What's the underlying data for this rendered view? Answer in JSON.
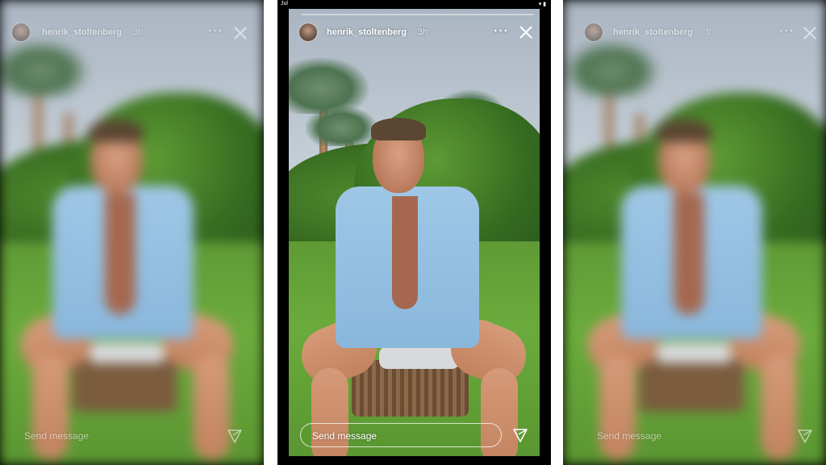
{
  "status_bar": {
    "time": "Jul",
    "icons": "wifi-icon, battery-icon"
  },
  "story": {
    "username": "henrik_stoltenberg",
    "time_ago": "3h",
    "more_icon": "more-dots-icon",
    "close_icon": "close-icon",
    "reply_placeholder": "Send message",
    "send_icon": "send-icon",
    "progress": 0.0
  },
  "colors": {
    "background": "#ffffff",
    "panel": "#000000",
    "text": "#ffffff"
  }
}
